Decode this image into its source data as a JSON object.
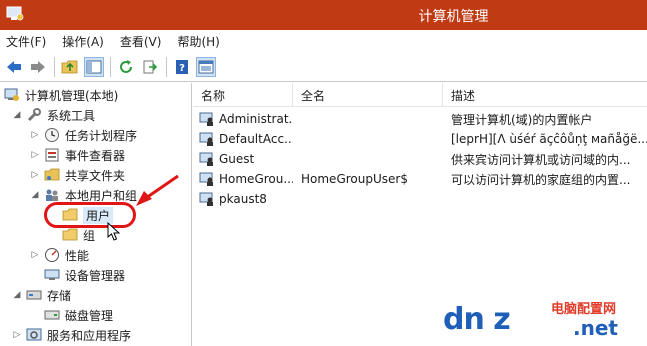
{
  "window": {
    "title": "计算机管理"
  },
  "menu": [
    "文件(F)",
    "操作(A)",
    "查看(V)",
    "帮助(H)"
  ],
  "toolbar": {
    "icons": [
      "back-arrow-icon",
      "forward-arrow-icon",
      "up-folder-icon",
      "show-hide-tree-icon",
      "refresh-icon",
      "export-list-icon",
      "help-icon",
      "properties-icon"
    ]
  },
  "tree": [
    {
      "label": "计算机管理(本地)",
      "expander": "",
      "icon": "computer-management-icon"
    },
    {
      "label": "系统工具",
      "expander": "◢",
      "icon": "tools-icon"
    },
    {
      "label": "任务计划程序",
      "expander": "▷",
      "icon": "clock-icon"
    },
    {
      "label": "事件查看器",
      "expander": "▷",
      "icon": "event-viewer-icon"
    },
    {
      "label": "共享文件夹",
      "expander": "▷",
      "icon": "shared-folder-icon"
    },
    {
      "label": "本地用户和组",
      "expander": "◢",
      "icon": "users-group-icon"
    },
    {
      "label": "用户",
      "expander": "",
      "icon": "folder-icon"
    },
    {
      "label": "组",
      "expander": "",
      "icon": "folder-icon"
    },
    {
      "label": "性能",
      "expander": "▷",
      "icon": "performance-icon"
    },
    {
      "label": "设备管理器",
      "expander": "",
      "icon": "device-manager-icon"
    },
    {
      "label": "存储",
      "expander": "◢",
      "icon": "storage-icon"
    },
    {
      "label": "磁盘管理",
      "expander": "",
      "icon": "disk-icon"
    },
    {
      "label": "服务和应用程序",
      "expander": "▷",
      "icon": "services-icon"
    }
  ],
  "list": {
    "columns": [
      "名称",
      "全名",
      "描述"
    ],
    "rows": [
      {
        "name": "Administrat...",
        "full": "",
        "desc": "管理计算机(域)的内置帐户"
      },
      {
        "name": "DefaultAcc...",
        "full": "",
        "desc": "[leprH][Λ ùśéŕ ãçĉôůņţ маñåğë..."
      },
      {
        "name": "Guest",
        "full": "",
        "desc": "供来宾访问计算机或访问域的内..."
      },
      {
        "name": "HomeGrou...",
        "full": "HomeGroupUser$",
        "desc": "可以访问计算机的家庭组的内置..."
      },
      {
        "name": "pkaust8",
        "full": "",
        "desc": ""
      }
    ]
  },
  "watermark": {
    "big": "dn z",
    "cn": "电脑配置网",
    "net": ".net"
  },
  "colors": {
    "titlebar": "#c03a14",
    "annotation": "#e01515",
    "watermark_blue": "#1f5fb8",
    "watermark_red": "#e23b2a"
  }
}
